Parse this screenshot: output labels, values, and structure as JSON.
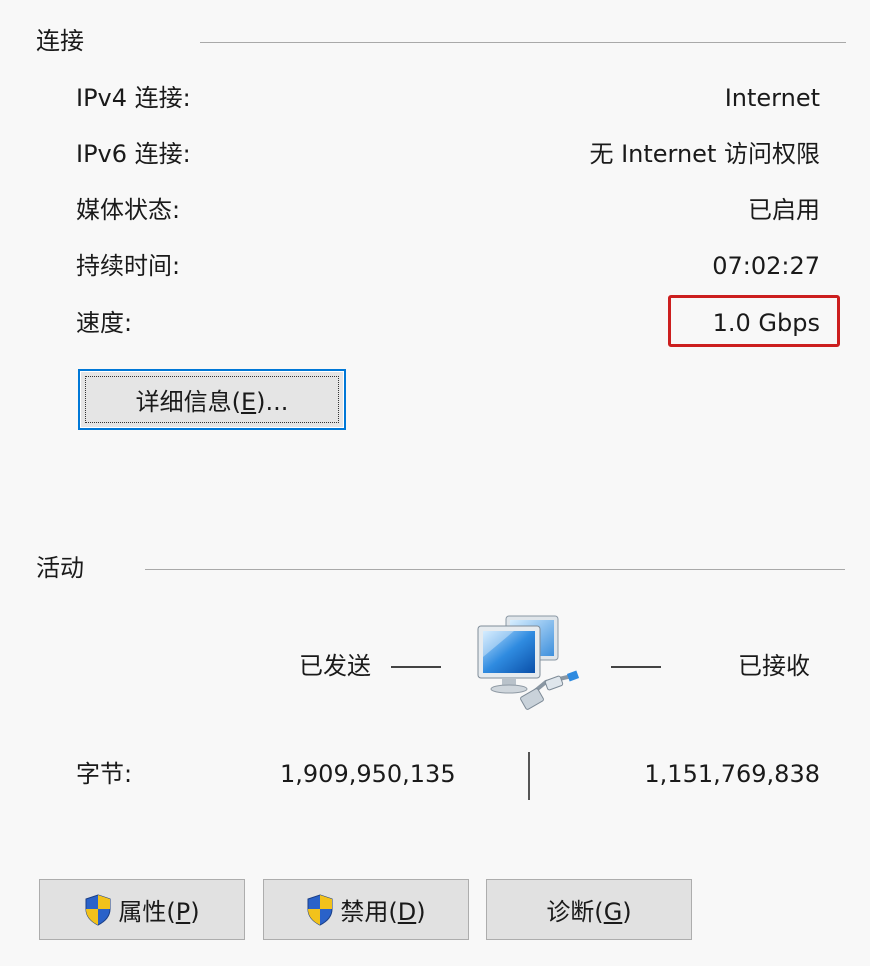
{
  "connection": {
    "title": "连接",
    "rows": [
      {
        "label": "IPv4 连接:",
        "value": "Internet"
      },
      {
        "label": "IPv6 连接:",
        "value": "无 Internet 访问权限"
      },
      {
        "label": "媒体状态:",
        "value": "已启用"
      },
      {
        "label": "持续时间:",
        "value": "07:02:27"
      },
      {
        "label": "速度:",
        "value": "1.0 Gbps"
      }
    ],
    "details_button": {
      "text": "详细信息(",
      "accel": "E",
      "suffix": ")..."
    }
  },
  "activity": {
    "title": "活动",
    "sent_label": "已发送",
    "received_label": "已接收",
    "bytes_label": "字节:",
    "bytes_sent": "1,909,950,135",
    "bytes_received": "1,151,769,838",
    "icon": "network-computers-icon"
  },
  "buttons": {
    "properties": {
      "text": "属性(",
      "accel": "P",
      "suffix": ")",
      "icon": "shield-icon"
    },
    "disable": {
      "text": "禁用(",
      "accel": "D",
      "suffix": ")",
      "icon": "shield-icon"
    },
    "diagnose": {
      "text": "诊断(",
      "accel": "G",
      "suffix": ")"
    }
  },
  "colors": {
    "highlight": "#cc1f1f",
    "focus_border": "#0078d7"
  }
}
